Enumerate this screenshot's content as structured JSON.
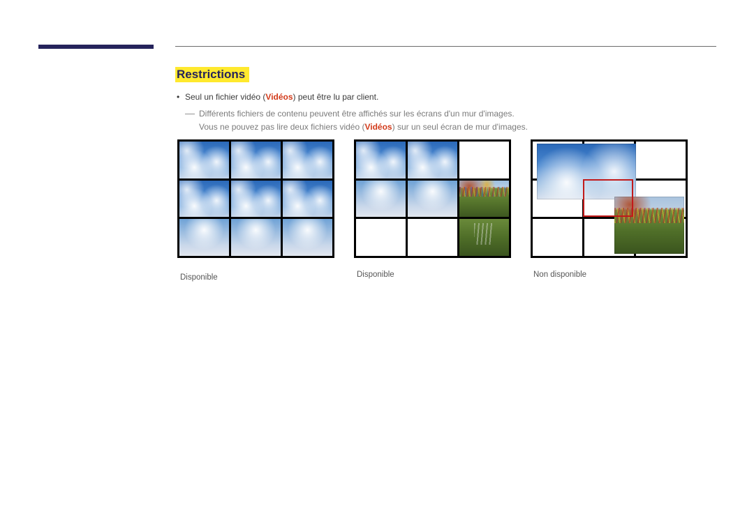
{
  "section": {
    "title": "Restrictions"
  },
  "bullets": {
    "item1_prefix": "Seul un fichier vidéo (",
    "item1_videos": "Vidéos",
    "item1_suffix": ") peut être lu par client.",
    "sub_line1": "Différents fichiers de contenu peuvent être affichés sur les écrans d'un mur d'images.",
    "sub_line2_prefix": "Vous ne pouvez pas lire deux fichiers vidéo (",
    "sub_line2_videos": "Vidéos",
    "sub_line2_suffix": ") sur un seul écran de mur d'images."
  },
  "captions": {
    "wall1": "Disponible",
    "wall2": "Disponible",
    "wall3": "Non disponible"
  }
}
